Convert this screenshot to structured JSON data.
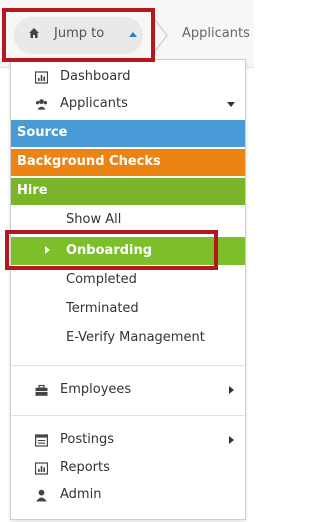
{
  "topbar": {
    "jump_label": "Jump to",
    "breadcrumb": "Applicants"
  },
  "menu": {
    "top_items": [
      {
        "label": "Dashboard",
        "icon": "bar-chart-icon"
      },
      {
        "label": "Applicants",
        "icon": "users-icon",
        "expandable": true
      }
    ],
    "sections": {
      "source": "Source",
      "background_checks": "Background Checks",
      "hire": "Hire"
    },
    "hire_items": [
      {
        "label": "Show All"
      },
      {
        "label": "Onboarding",
        "active": true
      },
      {
        "label": "Completed"
      },
      {
        "label": "Terminated"
      },
      {
        "label": "E-Verify Management"
      }
    ],
    "bottom_items": [
      {
        "label": "Employees",
        "icon": "briefcase-icon"
      },
      {
        "label": "Postings",
        "icon": "list-icon"
      },
      {
        "label": "Reports",
        "icon": "bar-chart-icon"
      },
      {
        "label": "Admin",
        "icon": "user-icon"
      }
    ]
  },
  "colors": {
    "source": "#4a9ad8",
    "background_checks": "#ec8414",
    "hire": "#79b429",
    "active": "#7cbf2b",
    "highlight": "#b3181e"
  }
}
